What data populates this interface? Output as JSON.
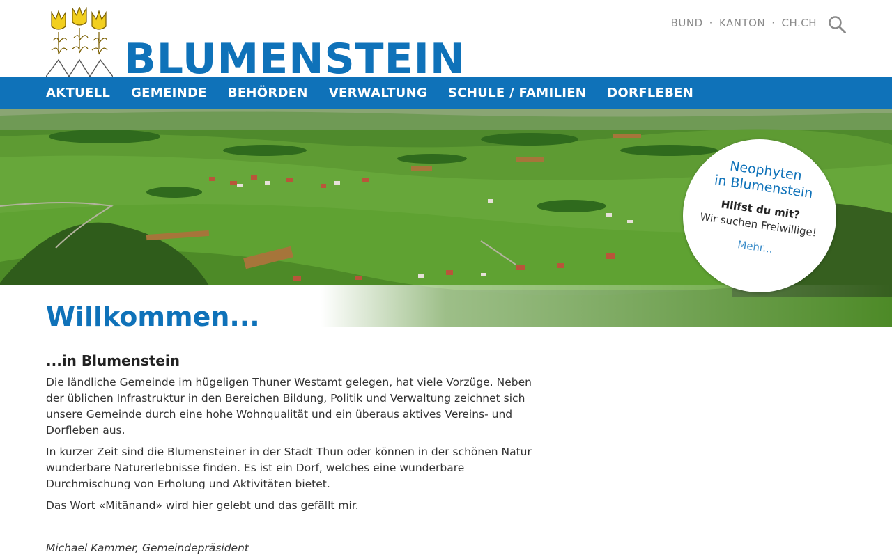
{
  "brand": {
    "name": "BLUMENSTEIN"
  },
  "top_links": [
    "BUND",
    "KANTON",
    "CH.CH"
  ],
  "top_links_separator": "·",
  "nav": {
    "items": [
      "AKTUELL",
      "GEMEINDE",
      "BEHÖRDEN",
      "VERWALTUNG",
      "SCHULE / FAMILIEN",
      "DORFLEBEN"
    ]
  },
  "badge": {
    "title_line1": "Neophyten",
    "title_line2": "in Blumenstein",
    "question": "Hilfst du mit?",
    "text": "Wir suchen Freiwillige!",
    "link": "Mehr..."
  },
  "content": {
    "title": "Willkommen...",
    "subtitle": "...in Blumenstein",
    "paragraphs": [
      "Die ländliche Gemeinde im hügeligen Thuner Westamt gelegen, hat viele Vorzüge. Neben der üblichen Infrastruktur in den Bereichen Bildung, Politik und Verwaltung zeichnet sich unsere Gemeinde durch eine hohe Wohnqualität und ein überaus aktives Vereins- und Dorfleben aus.",
      "In kurzer Zeit sind die Blumensteiner in der Stadt Thun oder können in der schönen Natur wunderbare Naturerlebnisse finden. Es ist ein Dorf, welches eine wunderbare Durchmischung von Erholung und Aktivitäten bietet.",
      "Das Wort «Mitänand» wird hier gelebt und das gefällt mir."
    ],
    "signature": "Michael Kammer, Gemeindepräsident"
  },
  "colors": {
    "brand_blue": "#0f72b9",
    "crest_yellow": "#f2cf1f"
  },
  "icons": {
    "search": "search-icon",
    "crest": "coat-of-arms-icon"
  }
}
